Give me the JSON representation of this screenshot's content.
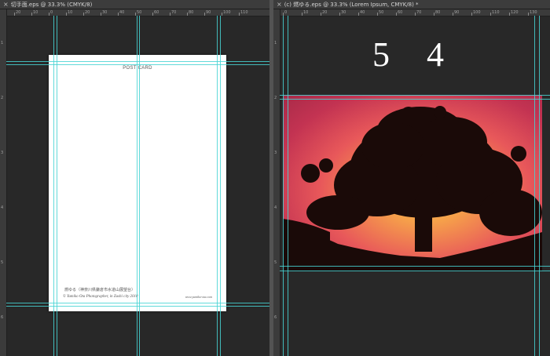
{
  "documents": {
    "left": {
      "tab_close": "×",
      "tab_title": "切手面.eps @ 33.3% (CMYK/8)",
      "ruler_ticks": [
        "20",
        "10",
        "0",
        "10",
        "20",
        "30",
        "40",
        "50",
        "60",
        "70",
        "80",
        "90",
        "100",
        "110"
      ],
      "postcard": {
        "title": "POST CARD",
        "caption": "燃ゆる（神奈川県鎌倉市水道山展望台）",
        "credit": "© Yumiko Ota Photographer, in Zushi city 2018",
        "website": "www.yumiko-ota.com"
      }
    },
    "right": {
      "tab_close": "×",
      "tab_title": "(c) 燃ゆる.eps @ 33.3% (Lorem Ipsum, CMYK/8) *",
      "ruler_ticks": [
        "0",
        "10",
        "20",
        "30",
        "40",
        "50",
        "60",
        "70",
        "80",
        "90",
        "100",
        "110",
        "120",
        "130"
      ],
      "page_number": "5 4"
    }
  },
  "colors": {
    "guide": "#46d4d4",
    "canvas": "#282828",
    "workspace": "#535353"
  },
  "icons": {
    "tab_close": "close-icon"
  }
}
